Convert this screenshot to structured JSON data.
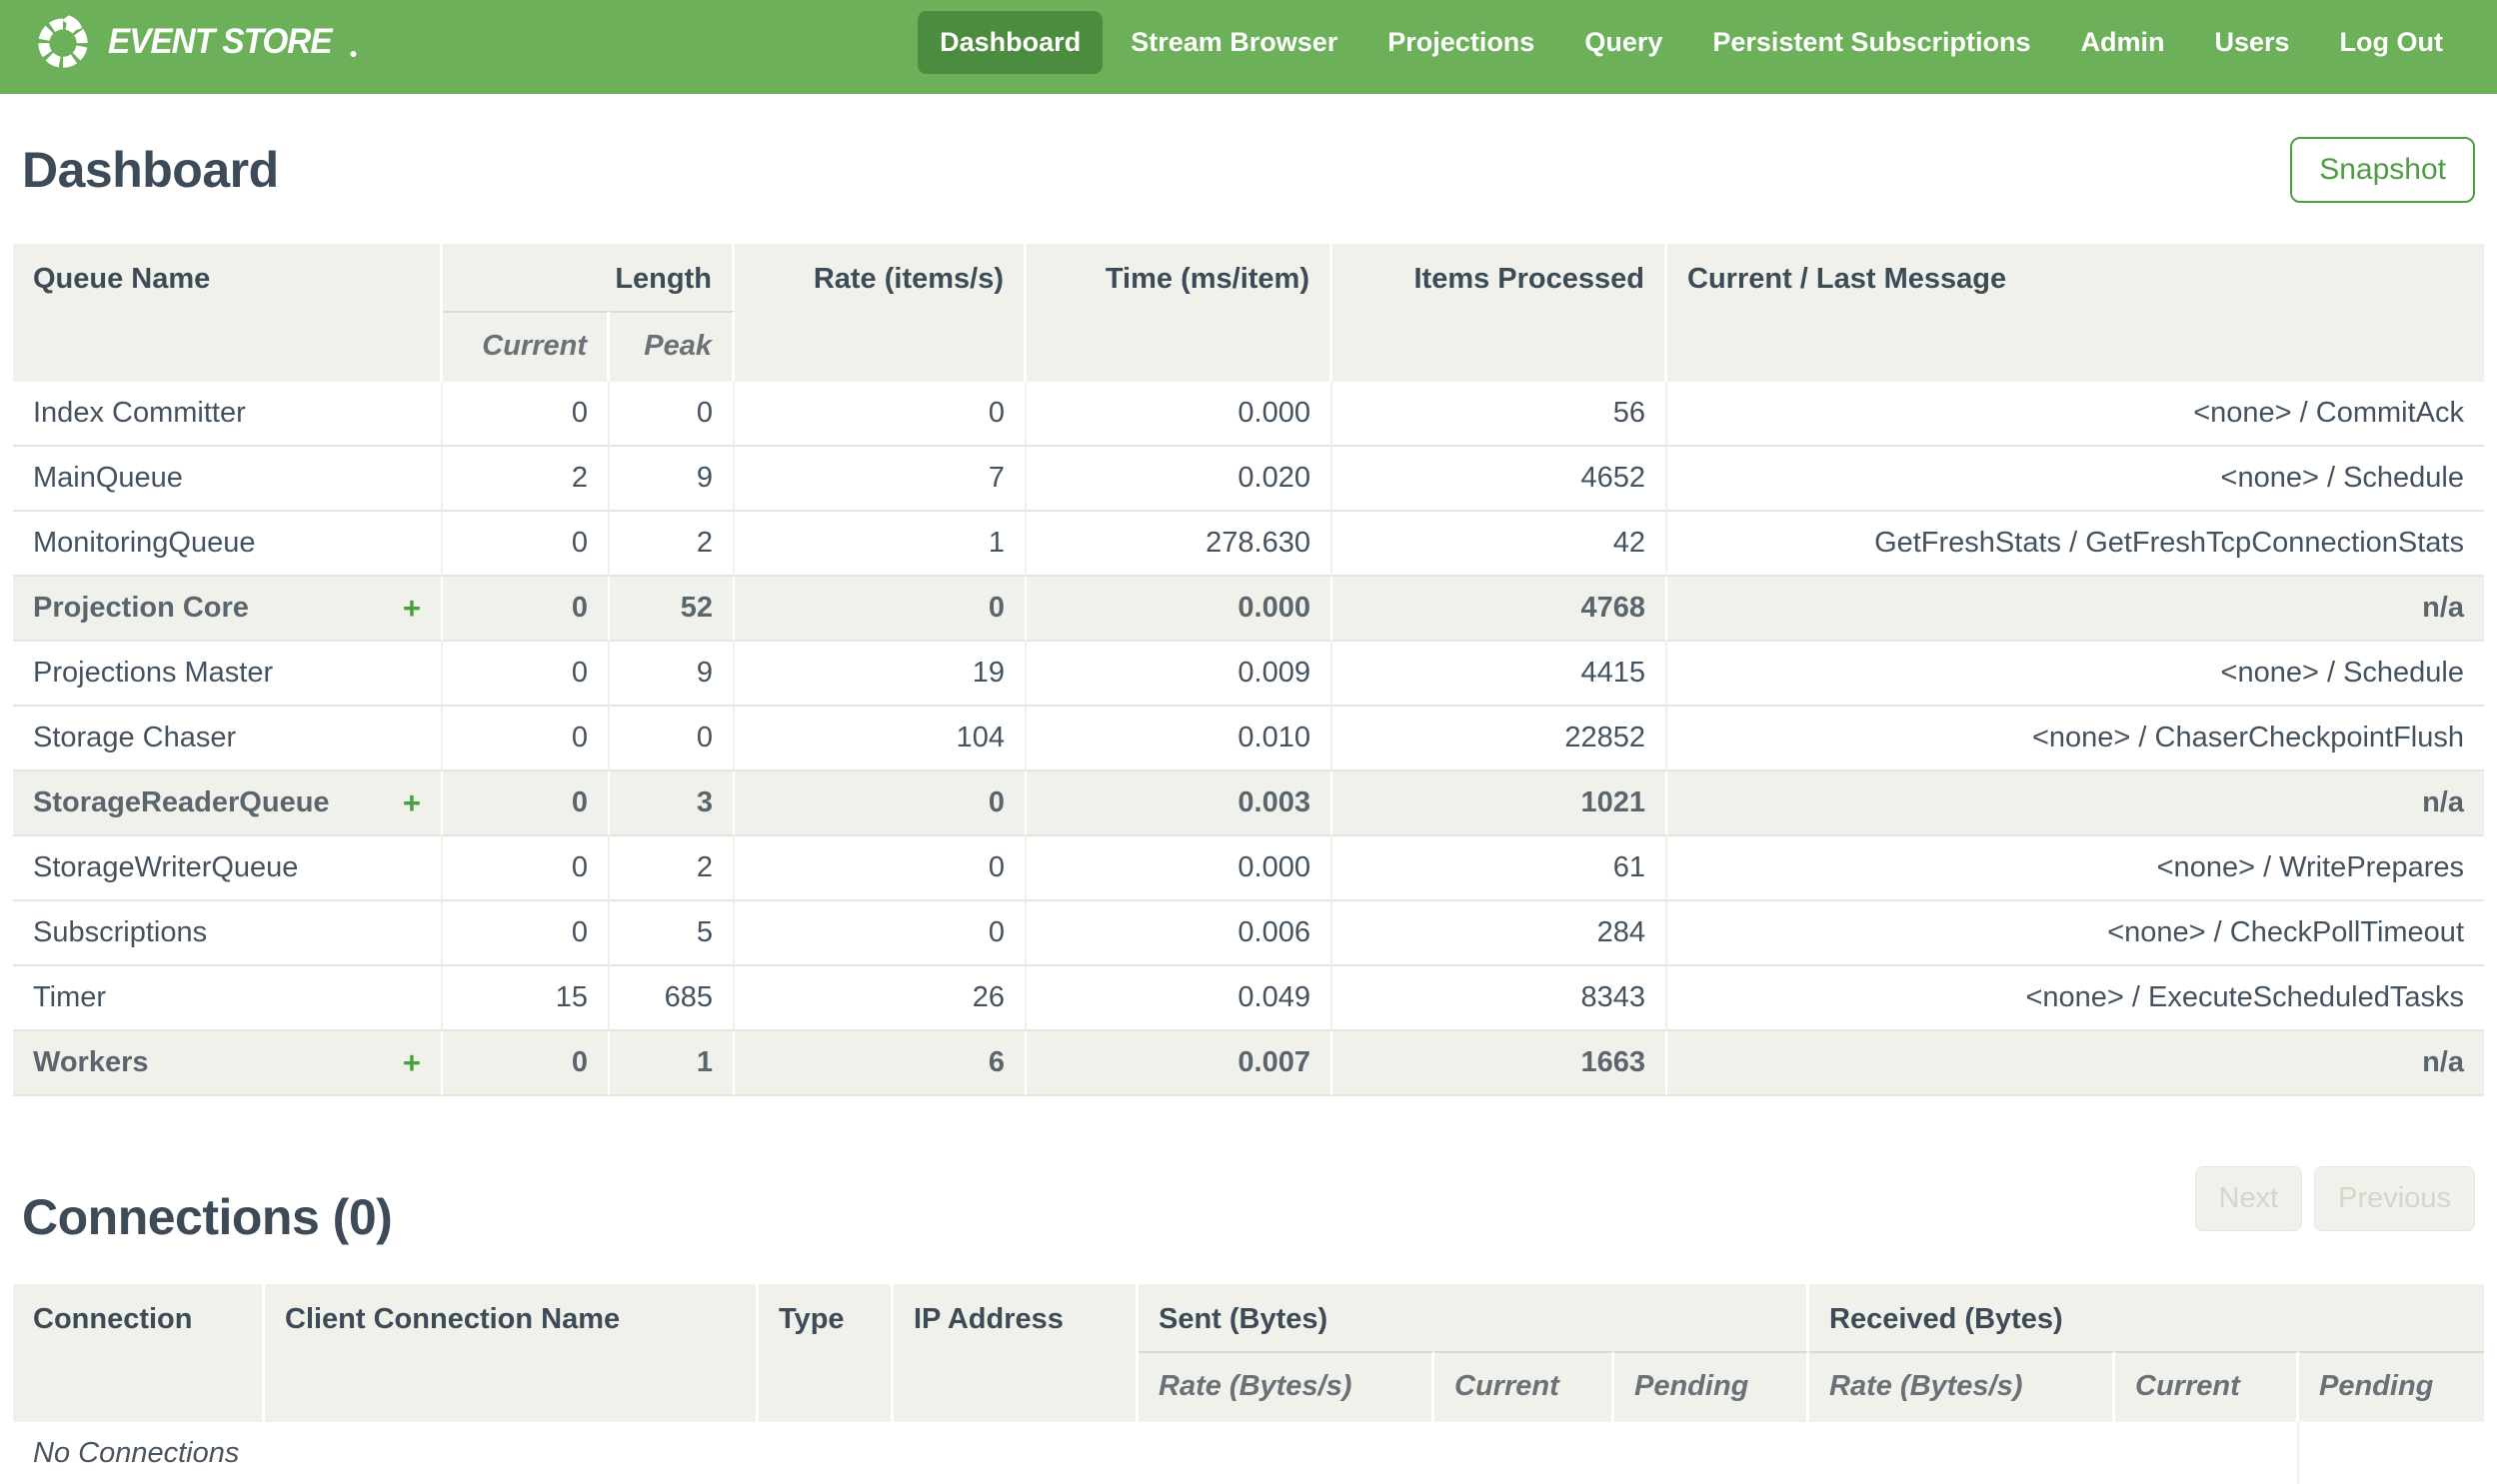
{
  "colors": {
    "brand_green": "#6cb15a",
    "active_nav_green": "#4c8c3e",
    "accent_green": "#4f9d43",
    "heading_slate": "#3d4a57",
    "table_header_bg": "#f0f1ea"
  },
  "nav": {
    "brand": "EVENT STORE",
    "items": [
      {
        "label": "Dashboard",
        "active": true
      },
      {
        "label": "Stream Browser",
        "active": false
      },
      {
        "label": "Projections",
        "active": false
      },
      {
        "label": "Query",
        "active": false
      },
      {
        "label": "Persistent Subscriptions",
        "active": false
      },
      {
        "label": "Admin",
        "active": false
      },
      {
        "label": "Users",
        "active": false
      },
      {
        "label": "Log Out",
        "active": false
      }
    ]
  },
  "page": {
    "title": "Dashboard",
    "snapshot_label": "Snapshot"
  },
  "queues": {
    "headers": {
      "queue_name": "Queue Name",
      "length": "Length",
      "current": "Current",
      "peak": "Peak",
      "rate": "Rate (items/s)",
      "time": "Time (ms/item)",
      "items_processed": "Items Processed",
      "message": "Current / Last Message"
    },
    "rows": [
      {
        "name": "Index Committer",
        "group": false,
        "current": "0",
        "peak": "0",
        "rate": "0",
        "time": "0.000",
        "items": "56",
        "message": "<none> / CommitAck"
      },
      {
        "name": "MainQueue",
        "group": false,
        "current": "2",
        "peak": "9",
        "rate": "7",
        "time": "0.020",
        "items": "4652",
        "message": "<none> / Schedule"
      },
      {
        "name": "MonitoringQueue",
        "group": false,
        "current": "0",
        "peak": "2",
        "rate": "1",
        "time": "278.630",
        "items": "42",
        "message": "GetFreshStats / GetFreshTcpConnectionStats"
      },
      {
        "name": "Projection Core",
        "group": true,
        "current": "0",
        "peak": "52",
        "rate": "0",
        "time": "0.000",
        "items": "4768",
        "message": "n/a"
      },
      {
        "name": "Projections Master",
        "group": false,
        "current": "0",
        "peak": "9",
        "rate": "19",
        "time": "0.009",
        "items": "4415",
        "message": "<none> / Schedule"
      },
      {
        "name": "Storage Chaser",
        "group": false,
        "current": "0",
        "peak": "0",
        "rate": "104",
        "time": "0.010",
        "items": "22852",
        "message": "<none> / ChaserCheckpointFlush"
      },
      {
        "name": "StorageReaderQueue",
        "group": true,
        "current": "0",
        "peak": "3",
        "rate": "0",
        "time": "0.003",
        "items": "1021",
        "message": "n/a"
      },
      {
        "name": "StorageWriterQueue",
        "group": false,
        "current": "0",
        "peak": "2",
        "rate": "0",
        "time": "0.000",
        "items": "61",
        "message": "<none> / WritePrepares"
      },
      {
        "name": "Subscriptions",
        "group": false,
        "current": "0",
        "peak": "5",
        "rate": "0",
        "time": "0.006",
        "items": "284",
        "message": "<none> / CheckPollTimeout"
      },
      {
        "name": "Timer",
        "group": false,
        "current": "15",
        "peak": "685",
        "rate": "26",
        "time": "0.049",
        "items": "8343",
        "message": "<none> / ExecuteScheduledTasks"
      },
      {
        "name": "Workers",
        "group": true,
        "current": "0",
        "peak": "1",
        "rate": "6",
        "time": "0.007",
        "items": "1663",
        "message": "n/a"
      }
    ],
    "expand_glyph": "+"
  },
  "connections": {
    "title": "Connections (0)",
    "next_label": "Next",
    "previous_label": "Previous",
    "headers": {
      "connection": "Connection",
      "client_connection_name": "Client Connection Name",
      "type": "Type",
      "ip_address": "IP Address",
      "sent": "Sent (Bytes)",
      "received": "Received (Bytes)",
      "sent_rate": "Rate (Bytes/s)",
      "sent_current": "Current",
      "sent_pending": "Pending",
      "received_rate": "Rate (Bytes/s)",
      "received_current": "Current",
      "received_pending": "Pending"
    },
    "empty_message": "No Connections"
  }
}
